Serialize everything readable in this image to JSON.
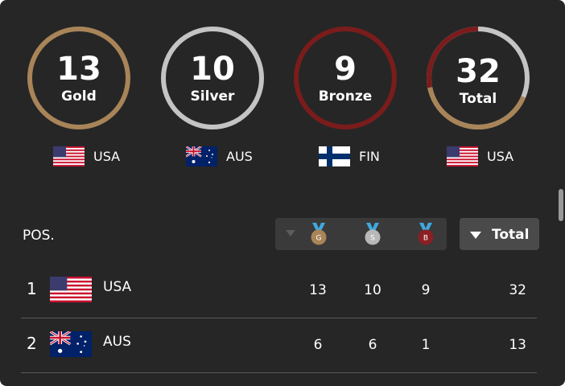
{
  "summary": [
    {
      "value": "13",
      "label": "Gold",
      "color": "#a88458",
      "leader": "USA"
    },
    {
      "value": "10",
      "label": "Silver",
      "color": "#c4c4c4",
      "leader": "AUS"
    },
    {
      "value": "9",
      "label": "Bronze",
      "color": "#7a1c1c",
      "leader": "FIN"
    },
    {
      "value": "32",
      "label": "Total",
      "color": "#c4c4c4",
      "leader": "USA"
    }
  ],
  "total_ring_share": {
    "gold": 13,
    "silver": 10,
    "bronze": 9,
    "total": 32
  },
  "table": {
    "pos_header": "POS.",
    "medal_icons": [
      {
        "letter": "G",
        "color": "#a88458"
      },
      {
        "letter": "S",
        "color": "#b8b8b8"
      },
      {
        "letter": "B",
        "color": "#8a1f24"
      }
    ],
    "sort_label": "Total",
    "rows": [
      {
        "pos": "1",
        "country": "USA",
        "flag": "usa-flag-icon",
        "gold": "13",
        "silver": "10",
        "bronze": "9",
        "total": "32"
      },
      {
        "pos": "2",
        "country": "AUS",
        "flag": "australia-flag-icon",
        "gold": "6",
        "silver": "6",
        "bronze": "1",
        "total": "13"
      }
    ]
  },
  "colors": {
    "panel": "#262626",
    "ribbon": "#3fa9e0",
    "divider": "#5a5a5a"
  }
}
